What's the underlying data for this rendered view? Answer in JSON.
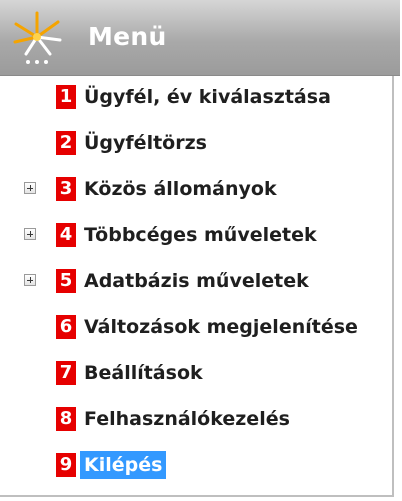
{
  "header": {
    "title": "Menü",
    "icon": "sparkle-icon"
  },
  "colors": {
    "number_badge": "#e60000",
    "selected_highlight": "#3399ff",
    "header_gradient_top": "#d6d6d6",
    "header_gradient_bottom": "#9b9b9b"
  },
  "menu": {
    "items": [
      {
        "number": "1",
        "label": "Ügyfél, év kiválasztása",
        "expandable": false,
        "selected": false
      },
      {
        "number": "2",
        "label": "Ügyféltörzs",
        "expandable": false,
        "selected": false
      },
      {
        "number": "3",
        "label": "Közös állományok",
        "expandable": true,
        "selected": false
      },
      {
        "number": "4",
        "label": "Többcéges műveletek",
        "expandable": true,
        "selected": false
      },
      {
        "number": "5",
        "label": "Adatbázis műveletek",
        "expandable": true,
        "selected": false
      },
      {
        "number": "6",
        "label": "Változások megjelenítése",
        "expandable": false,
        "selected": false
      },
      {
        "number": "7",
        "label": "Beállítások",
        "expandable": false,
        "selected": false
      },
      {
        "number": "8",
        "label": "Felhasználókezelés",
        "expandable": false,
        "selected": false
      },
      {
        "number": "9",
        "label": "Kilépés",
        "expandable": false,
        "selected": true
      }
    ]
  }
}
